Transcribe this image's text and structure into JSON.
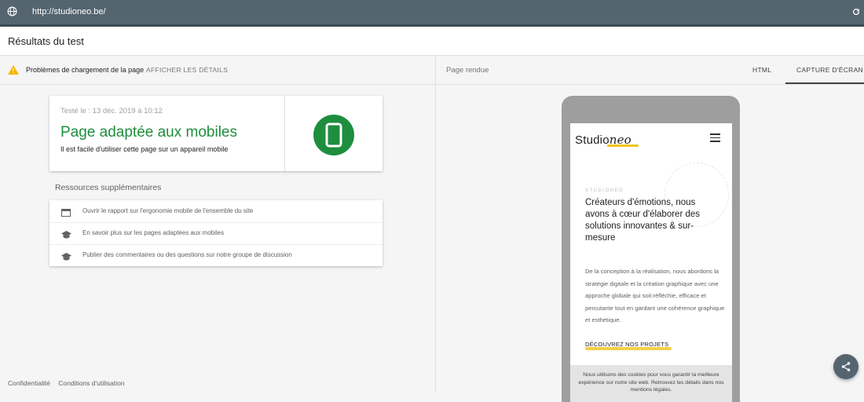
{
  "browser": {
    "url": "http://studioneo.be/",
    "globe_icon": "globe-icon",
    "reload_icon": "reload-icon"
  },
  "header": {
    "title": "Résultats du test"
  },
  "warning": {
    "text": "Problèmes de chargement de la page",
    "link": "AFFICHER LES DÉTAILS",
    "icon": "warning-icon",
    "color": "#f4b400"
  },
  "result_card": {
    "date": "Testé le : 13 déc. 2019 à 10:12",
    "verdict": "Page adaptée aux mobiles",
    "description": "Il est facile d'utiliser cette page sur un appareil mobile",
    "color": "#1e8e3e",
    "icon": "smartphone-icon"
  },
  "resources": {
    "title": "Ressources supplémentaires",
    "items": [
      {
        "label": "Ouvrir le rapport sur l'ergonomie mobile de l'ensemble du site",
        "icon": "report-icon"
      },
      {
        "label": "En savoir plus sur les pages adaptées aux mobiles",
        "icon": "graduation-cap-icon"
      },
      {
        "label": "Publier des commentaires ou des questions sur notre groupe de discussion",
        "icon": "graduation-cap-icon"
      }
    ]
  },
  "footer": {
    "privacy": "Confidentialité",
    "terms": "Conditions d'utilisation"
  },
  "right_panel": {
    "label": "Page rendue",
    "tabs": [
      {
        "label": "HTML",
        "active": false
      },
      {
        "label": "CAPTURE D'ÉCRAN",
        "active": true
      }
    ]
  },
  "rendered_page": {
    "logo_prefix": "Studio",
    "logo_suffix": "neo",
    "small_label": "STUDIONEO",
    "headline": "Créateurs d'émotions, nous avons à cœur d'élaborer des solutions innovantes & sur-mesure",
    "body": "De la conception à la réalisation, nous abordons la stratégie digitale et la création graphique avec une approche globale qui soit réfléchie, efficace et percutante tout en gardant une cohérence graphique et esthétique.",
    "cta": "DÉCOUVREZ NOS PROJETS",
    "accent": "#f0c419",
    "cookie_text": "Nous utilisons des cookies pour vous garantir la meilleure expérience sur notre site web. Retrouvez les détails dans nos mentions légales."
  },
  "share_icon": "share-icon"
}
